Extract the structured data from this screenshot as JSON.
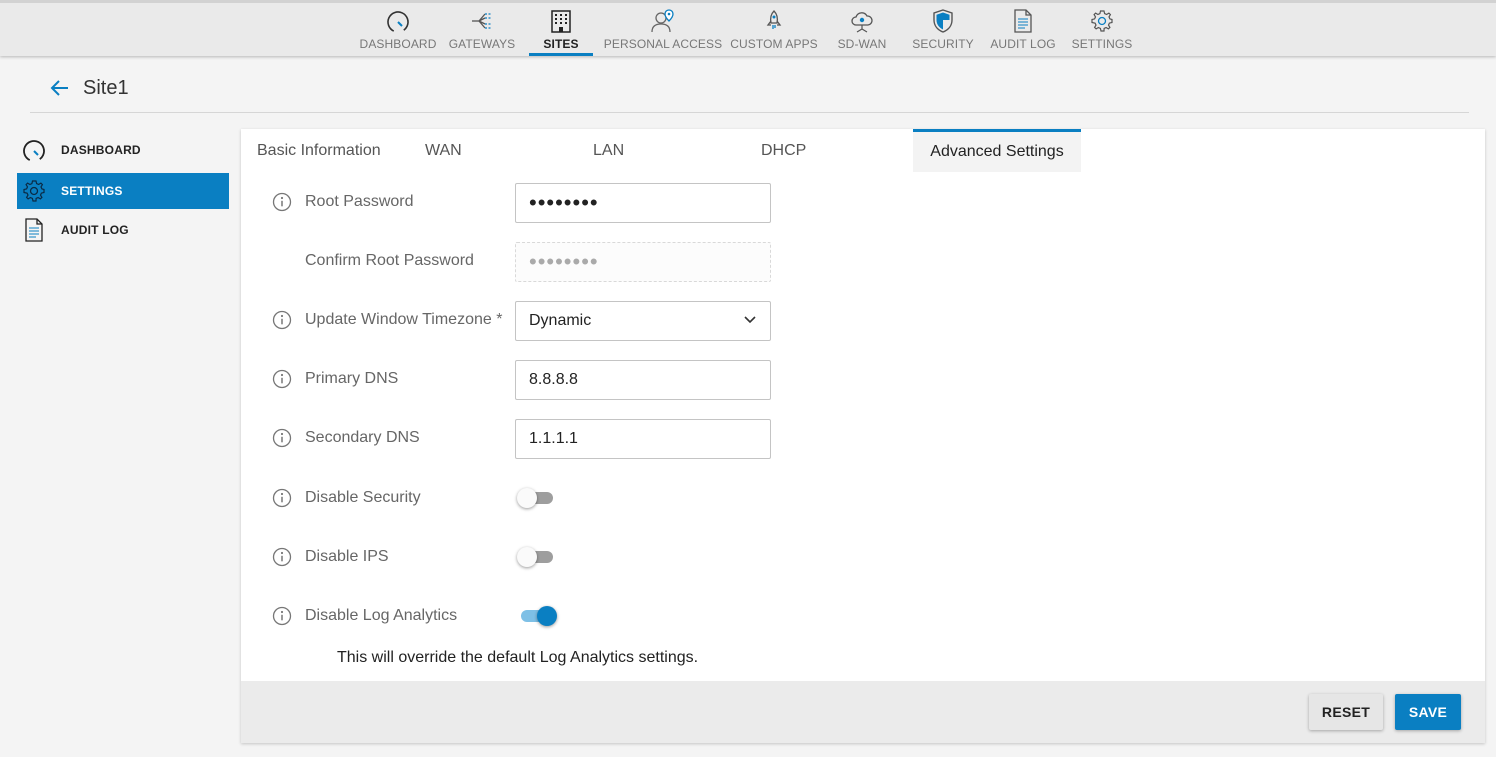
{
  "topnav": {
    "items": [
      {
        "label": "DASHBOARD",
        "icon": "gauge-icon"
      },
      {
        "label": "GATEWAYS",
        "icon": "network-icon"
      },
      {
        "label": "SITES",
        "icon": "building-icon",
        "active": true
      },
      {
        "label": "PERSONAL ACCESS",
        "icon": "user-location-icon"
      },
      {
        "label": "CUSTOM APPS",
        "icon": "rocket-icon"
      },
      {
        "label": "SD-WAN",
        "icon": "cloud-network-icon"
      },
      {
        "label": "SECURITY",
        "icon": "shield-icon"
      },
      {
        "label": "AUDIT LOG",
        "icon": "document-icon"
      },
      {
        "label": "SETTINGS",
        "icon": "gear-icon"
      }
    ]
  },
  "header": {
    "title": "Site1"
  },
  "sidebar": {
    "items": [
      {
        "label": "DASHBOARD",
        "icon": "gauge-icon"
      },
      {
        "label": "SETTINGS",
        "icon": "gear-icon",
        "active": true
      },
      {
        "label": "AUDIT LOG",
        "icon": "document-icon"
      }
    ]
  },
  "tabs": [
    "Basic Information",
    "WAN",
    "LAN",
    "DHCP",
    "Advanced Settings"
  ],
  "active_tab": "Advanced Settings",
  "form": {
    "root_password": {
      "label": "Root Password",
      "value": "••••••••"
    },
    "confirm_root_password": {
      "label": "Confirm Root Password",
      "value": "••••••••"
    },
    "timezone": {
      "label": "Update Window Timezone *",
      "value": "Dynamic"
    },
    "primary_dns": {
      "label": "Primary DNS",
      "value": "8.8.8.8"
    },
    "secondary_dns": {
      "label": "Secondary DNS",
      "value": "1.1.1.1"
    },
    "disable_security": {
      "label": "Disable Security",
      "on": false
    },
    "disable_ips": {
      "label": "Disable IPS",
      "on": false
    },
    "disable_log_analytics": {
      "label": "Disable Log Analytics",
      "on": true
    },
    "note": "This will override the default Log Analytics settings."
  },
  "footer": {
    "reset_label": "RESET",
    "save_label": "SAVE"
  },
  "colors": {
    "accent": "#0a7fc2",
    "toggle_on_track": "#7ec0e6",
    "toggle_off_track": "#9e9e9e"
  }
}
